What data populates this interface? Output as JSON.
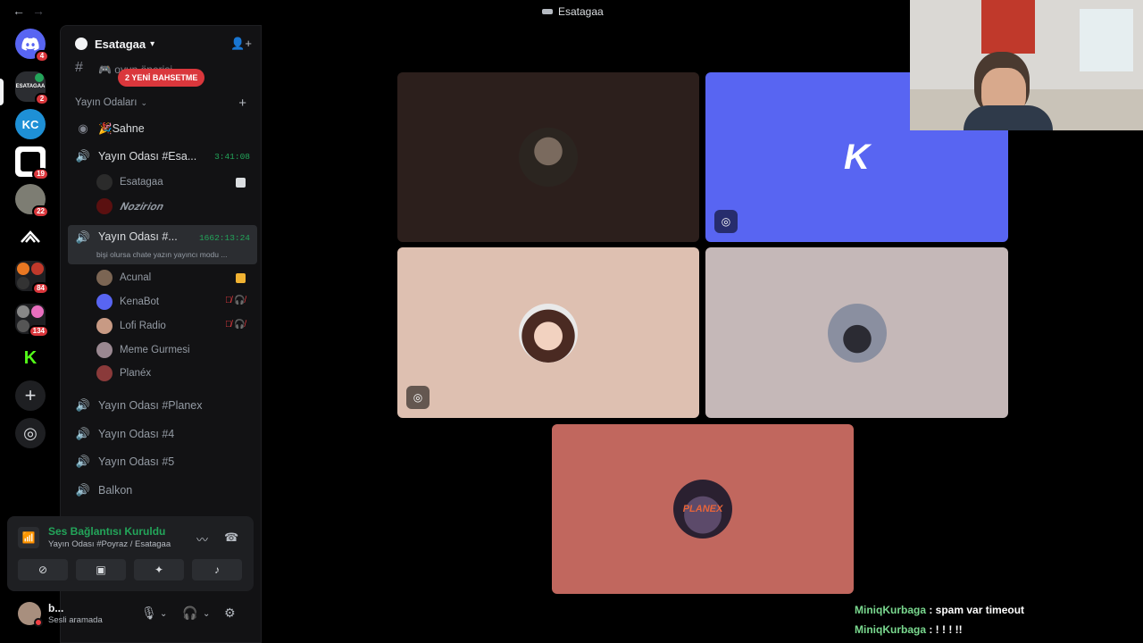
{
  "window": {
    "title": "Esatagaa",
    "back_glyph": "←",
    "forward_glyph": "→"
  },
  "rail": {
    "servers": [
      {
        "name": "discord-home",
        "badge": "4",
        "color": "#5865f2"
      },
      {
        "name": "esatagaa",
        "badge": "2",
        "label": "ESATAGAA",
        "color": "#2b2d31"
      },
      {
        "name": "kc-server",
        "label": "KC",
        "color": "#1e90d6"
      },
      {
        "name": "kenabot-server",
        "badge": "19",
        "color": "#ffffff"
      },
      {
        "name": "anime-server",
        "badge": "22",
        "color": "#7d7d73"
      },
      {
        "name": "peak-server",
        "color": "#000000"
      },
      {
        "name": "folder-1",
        "badge": "84",
        "color": "#e87722"
      },
      {
        "name": "folder-2",
        "badge": "134",
        "color": "#6d6d6d"
      },
      {
        "name": "kick-server",
        "color": "#53fc18"
      }
    ],
    "add_server_glyph": "+",
    "explore_glyph": "◎"
  },
  "sidebar": {
    "server_name": "Esatagaa",
    "mention_pill": "2 YENİ BAHSETME",
    "hidden_channel": "🎮 oyun önerisi",
    "category": "Yayın Odaları",
    "channels": [
      {
        "id": "sahne",
        "label": "🎉Sahne",
        "icon": "stage"
      },
      {
        "id": "esatagaa-room",
        "label": "Yayın Odası #Esa...",
        "time": "3:41:08",
        "icon": "voice-live"
      },
      {
        "id": "poyraz-room",
        "label": "Yayın Odası #...",
        "time": "1662:13:24",
        "sub": "bişi olursa chate yazın yayıncı modu ...",
        "icon": "voice-live"
      },
      {
        "id": "planex-room",
        "label": "Yayın Odası #Planex",
        "icon": "voice"
      },
      {
        "id": "room-4",
        "label": "Yayın Odası #4",
        "icon": "voice"
      },
      {
        "id": "room-5",
        "label": "Yayın Odası #5",
        "icon": "voice"
      },
      {
        "id": "balkon",
        "label": "Balkon",
        "icon": "voice"
      }
    ],
    "room1_members": [
      {
        "name": "Esatagaa",
        "color": "#2b2b2b"
      },
      {
        "name": "𝑵𝒐𝒛𝒊𝒓𝒊𝒐𝒏",
        "color": "#5a1010"
      }
    ],
    "room2_members": [
      {
        "name": "Acunal",
        "color": "#7b6553"
      },
      {
        "name": "KenaBot",
        "color": "#5865f2",
        "icons": "🎙̸ 🎧̸"
      },
      {
        "name": "Lofi Radio",
        "color": "#c89a84",
        "icons": "🎙̸ 🎧̸"
      },
      {
        "name": "Meme Gurmesi",
        "color": "#9a8891"
      },
      {
        "name": "Planéx",
        "color": "#8a3a3a"
      }
    ]
  },
  "voice_panel": {
    "status": "Ses Bağlantısı Kuruldu",
    "location": "Yayın Odası #Poyraz / Esatagaa",
    "buttons": [
      "camera-off",
      "screen-share",
      "activities",
      "soundboard"
    ]
  },
  "user_panel": {
    "name": "b...",
    "status": "Sesli aramada"
  },
  "stage": {
    "tiles": [
      {
        "id": "acunal",
        "bg": "#2c1f1c",
        "avatar_bg": "#4a4038"
      },
      {
        "id": "kenabot",
        "bg": "#5865f2",
        "avatar_bg": "#5865f2",
        "streaming": true,
        "logo": "K"
      },
      {
        "id": "lofi",
        "bg": "#dec0b1",
        "avatar_bg": "#e8b9a4",
        "streaming": true
      },
      {
        "id": "meme",
        "bg": "#c5b8b8",
        "avatar_bg": "#6f7585"
      },
      {
        "id": "planex",
        "bg": "#c1675e",
        "avatar_bg": "#3c2f44",
        "logo": "PLANEX"
      }
    ]
  },
  "chat": [
    {
      "user": "MiniqKurbaga",
      "text": ": spam var timeout"
    },
    {
      "user": "MiniqKurbaga",
      "text": ": ! ! ! !!"
    }
  ]
}
